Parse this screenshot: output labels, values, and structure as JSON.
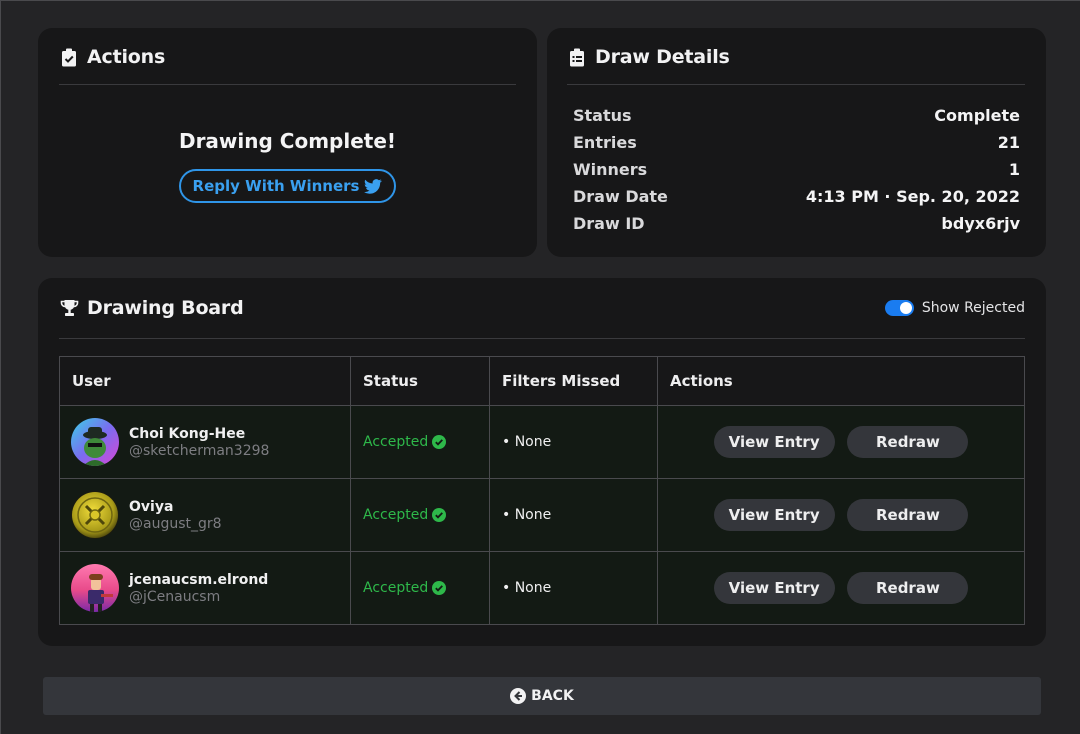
{
  "actions": {
    "title": "Actions",
    "title_icon": "clipboard-check-icon",
    "complete_message": "Drawing Complete!",
    "reply_button": "Reply With Winners",
    "reply_icon": "twitter-icon"
  },
  "details": {
    "title": "Draw Details",
    "title_icon": "clipboard-list-icon",
    "rows": [
      {
        "label": "Status",
        "value": "Complete"
      },
      {
        "label": "Entries",
        "value": "21"
      },
      {
        "label": "Winners",
        "value": "1"
      },
      {
        "label": "Draw Date",
        "value": "4:13 PM · Sep. 20, 2022"
      },
      {
        "label": "Draw ID",
        "value": "bdyx6rjv"
      }
    ]
  },
  "board": {
    "title": "Drawing Board",
    "title_icon": "trophy-icon",
    "toggle_label": "Show Rejected",
    "toggle_on": true,
    "columns": [
      "User",
      "Status",
      "Filters Missed",
      "Actions"
    ],
    "rows": [
      {
        "name": "Choi Kong-Hee",
        "handle": "@sketcherman3298",
        "status": "Accepted",
        "filters": "• None",
        "view_label": "View Entry",
        "redraw_label": "Redraw"
      },
      {
        "name": "Oviya",
        "handle": "@august_gr8",
        "status": "Accepted",
        "filters": "• None",
        "view_label": "View Entry",
        "redraw_label": "Redraw"
      },
      {
        "name": "jcenaucsm.elrond",
        "handle": "@jCenaucsm",
        "status": "Accepted",
        "filters": "• None",
        "view_label": "View Entry",
        "redraw_label": "Redraw"
      }
    ]
  },
  "back_button": "BACK",
  "colors": {
    "accent_blue": "#2f95e8",
    "accepted_green": "#2eb84a",
    "card_bg": "#171718",
    "page_bg": "#242426"
  }
}
